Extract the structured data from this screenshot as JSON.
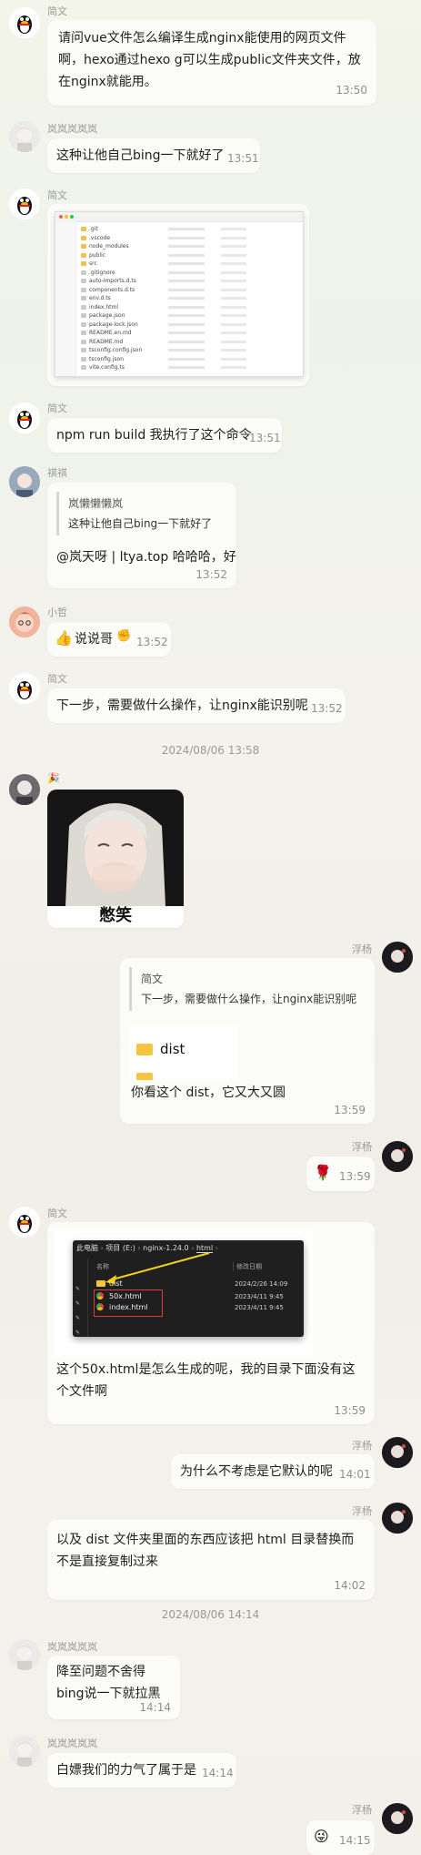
{
  "messages": {
    "m1": {
      "name": "简文",
      "text": "请问vue文件怎么编译生成nginx能使用的网页文件啊，hexo通过hexo g可以生成public文件夹文件，放在nginx就能用。",
      "time": "13:50"
    },
    "m2": {
      "name": "岚岚岚岚岚",
      "text": "这种让他自己bing一下就好了",
      "time": "13:51"
    },
    "m3": {
      "name": "简文",
      "file_rows": [
        ".git",
        ".vscode",
        "node_modules",
        "public",
        "src",
        ".gitignore",
        "auto-imports.d.ts",
        "components.d.ts",
        "env.d.ts",
        "index.html",
        "package.json",
        "package-lock.json",
        "README.en.md",
        "README.md",
        "tsconfig.config.json",
        "tsconfig.json",
        "vite.config.ts"
      ]
    },
    "m4": {
      "name": "简文",
      "text": "npm run build 我执行了这个命令",
      "time": "13:51"
    },
    "m5": {
      "name": "祺祺",
      "quote_name": "岚懒懒懒岚",
      "quote_text": "这种让他自己bing一下就好了",
      "text": "@岚天呀 | ltya.top 哈哈哈，好",
      "time": "13:52"
    },
    "m6": {
      "name": "小哲",
      "text": "说说哥",
      "emoji": "👍",
      "emoji2": "✊",
      "time": "13:52"
    },
    "m7": {
      "name": "简文",
      "text": "下一步，需要做什么操作，让nginx能识别呢",
      "time": "13:52"
    },
    "sep1": "2024/08/06 13:58",
    "m8": {
      "sticker_caption": "憋笑"
    },
    "m9": {
      "name": "浮杨",
      "quote_name": "简文",
      "quote_text": "下一步，需要做什么操作，让nginx能识别呢",
      "folder": "dist",
      "text": "你看这个 dist，它又大又圆",
      "time": "13:59"
    },
    "m10": {
      "name": "浮杨",
      "text": "🌹",
      "time": "13:59"
    },
    "m11": {
      "name": "简文",
      "explorer": {
        "path": [
          "此电脑",
          "项目 (E:)",
          "nginx-1.24.0",
          "html"
        ],
        "col_name": "名称",
        "col_date": "修改日期",
        "rows": [
          {
            "name": "dist",
            "date": "2024/2/26 14:09"
          },
          {
            "name": "50x.html",
            "date": "2023/4/11 9:45"
          },
          {
            "name": "index.html",
            "date": "2023/4/11 9:45"
          }
        ]
      },
      "text": "这个50x.html是怎么生成的呢，我的目录下面没有这个文件啊",
      "time": "13:59"
    },
    "m12": {
      "name": "浮杨",
      "text": "为什么不考虑是它默认的呢",
      "time": "14:01"
    },
    "m13": {
      "name": "浮杨",
      "text": "以及 dist 文件夹里面的东西应该把 html 目录替换而不是直接复制过来",
      "time": "14:02"
    },
    "sep2": "2024/08/06 14:14",
    "m14": {
      "name": "岚岚岚岚岚",
      "text": "降至问题不舍得bing说一下就拉黑",
      "time": "14:14"
    },
    "m15": {
      "name": "岚岚岚岚岚",
      "text": "白嫖我们的力气了属于是",
      "time": "14:14"
    },
    "m16": {
      "name": "浮杨",
      "emoji": "😜",
      "time": "14:15"
    }
  }
}
